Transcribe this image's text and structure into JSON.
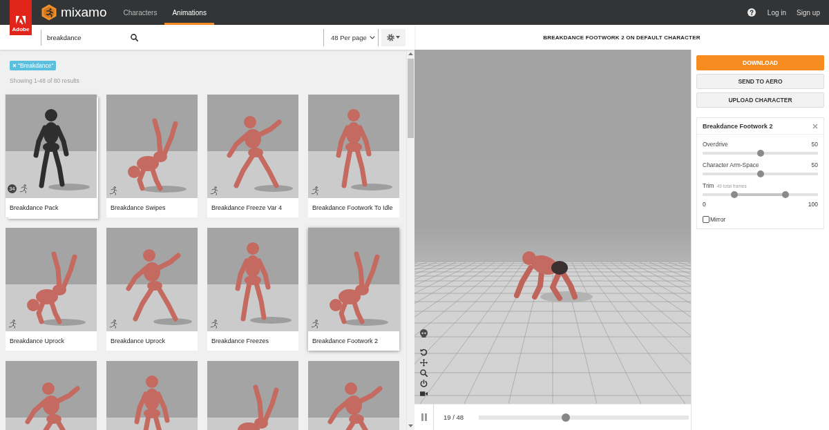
{
  "top_bar": {
    "brand_badge": "Adobe",
    "logo_text": "mixamo",
    "nav": [
      {
        "label": "Characters",
        "selected": false
      },
      {
        "label": "Animations",
        "selected": true
      }
    ],
    "links": [
      "Log in",
      "Sign up"
    ]
  },
  "toolbar": {
    "search": {
      "value": "breakdance"
    },
    "per_page": "48 Per page"
  },
  "filter_tags": [
    {
      "label": "\"Breakdance\""
    }
  ],
  "results_summary": "Showing 1-48 of 80 results",
  "cards": [
    {
      "kind": "pack",
      "title": "Breakdance Pack",
      "count": "34",
      "selected": false
    },
    {
      "kind": "animation",
      "title": "Breakdance Swipes",
      "selected": false
    },
    {
      "kind": "animation",
      "title": "Breakdance Freeze Var 4",
      "selected": false
    },
    {
      "kind": "animation",
      "title": "Breakdance Footwork To Idle",
      "selected": false
    },
    {
      "kind": "animation",
      "title": "Breakdance Uprock",
      "selected": false
    },
    {
      "kind": "animation",
      "title": "Breakdance Uprock",
      "selected": false
    },
    {
      "kind": "animation",
      "title": "Breakdance Freezes",
      "selected": false
    },
    {
      "kind": "animation",
      "title": "Breakdance Footwork 2",
      "selected": true
    },
    {
      "kind": "animation",
      "selected": false
    },
    {
      "kind": "animation",
      "selected": false
    },
    {
      "kind": "animation",
      "selected": false
    },
    {
      "kind": "animation",
      "selected": false
    }
  ],
  "preview": {
    "title": "BREAKDANCE FOOTWORK 2 ON DEFAULT CHARACTER",
    "playing": true,
    "frame": "19 / 48",
    "timeline": {
      "level": 0.41
    }
  },
  "actions": [
    {
      "label": "DOWNLOAD",
      "kind": "primary"
    },
    {
      "label": "SEND TO AERO",
      "kind": "secondary"
    },
    {
      "label": "UPLOAD CHARACTER",
      "kind": "secondary"
    }
  ],
  "settings": {
    "title": "Breakdance Footwork 2",
    "sliders": [
      {
        "kind": "single",
        "label": "Overdrive",
        "value": "50",
        "level": 0.5
      },
      {
        "kind": "single",
        "label": "Character Arm-Space",
        "value": "50",
        "level": 0.5
      },
      {
        "kind": "range",
        "label": "Trim",
        "note": "49 total frames",
        "handles": [
          {
            "level": 0.26
          },
          {
            "level": 0.73
          }
        ],
        "min": "0",
        "max": "100"
      }
    ],
    "mirror": {
      "label": "Mirror",
      "checked": false
    }
  }
}
